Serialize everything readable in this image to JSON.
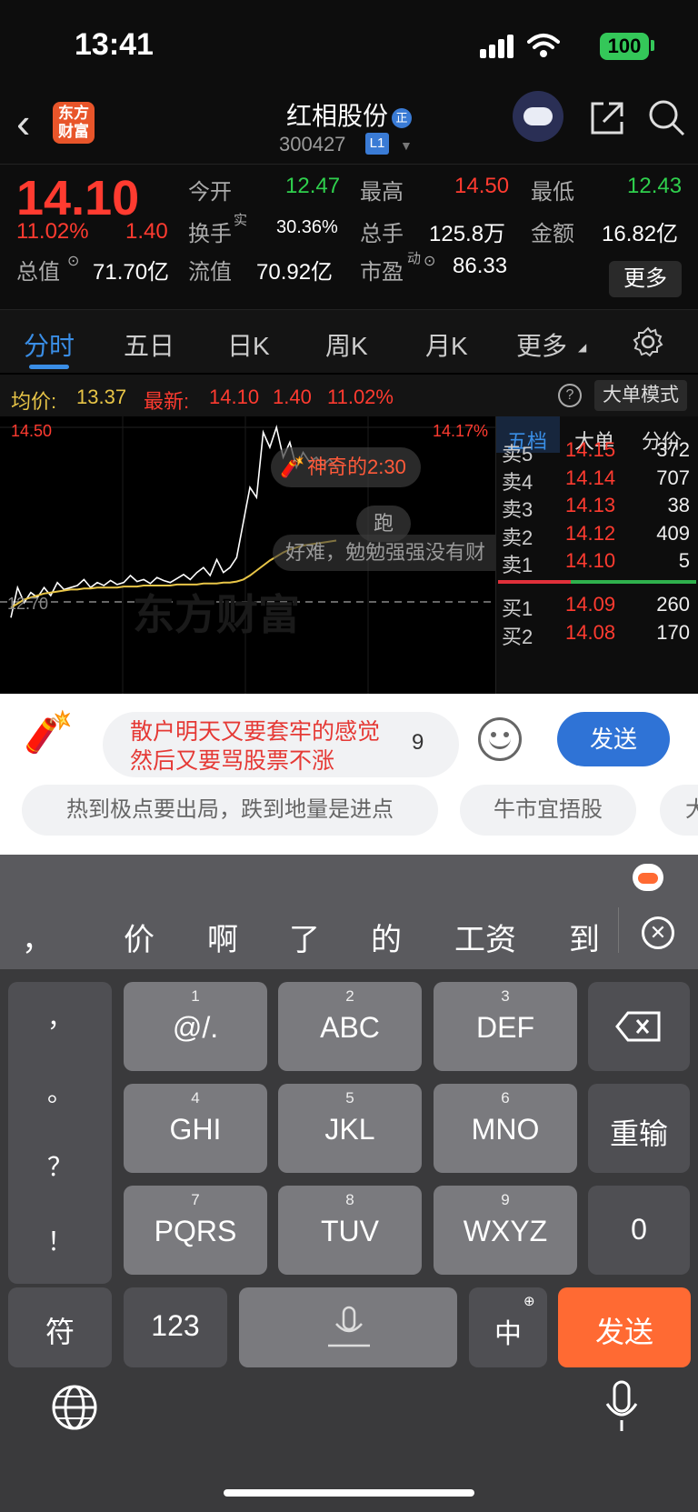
{
  "status": {
    "time": "13:41",
    "battery": "100"
  },
  "nav": {
    "brand": "东方财富",
    "title": "红相股份",
    "title_badge": "正",
    "code": "300427",
    "level": "L1"
  },
  "quote": {
    "price": "14.10",
    "change_pct": "11.02%",
    "change": "1.40",
    "open_label": "今开",
    "open": "12.47",
    "high_label": "最高",
    "high": "14.50",
    "low_label": "最低",
    "low": "12.43",
    "turnover_label": "换手",
    "turnover_sup": "实",
    "turnover": "30.36%",
    "volume_label": "总手",
    "volume": "125.8万",
    "amount_label": "金额",
    "amount": "16.82亿",
    "mktcap_label": "总值",
    "mktcap": "71.70亿",
    "float_label": "流值",
    "float": "70.92亿",
    "pe_label": "市盈",
    "pe_sup": "动",
    "pe": "86.33",
    "more": "更多"
  },
  "tabs": [
    "分时",
    "五日",
    "日K",
    "周K",
    "月K",
    "更多"
  ],
  "priceline": {
    "avg_label": "均价:",
    "avg": "13.37",
    "last_label": "最新:",
    "last": "14.10",
    "chg": "1.40",
    "pct": "11.02%",
    "mode": "大单模式"
  },
  "chart": {
    "high_label": "14.50",
    "pct_label": "14.17%",
    "base_label": "12.70",
    "watermark": "东方财富",
    "danmaku": [
      "神奇的2:30",
      "跑",
      "好难，勉勉强强没有财"
    ]
  },
  "chart_data": {
    "type": "line",
    "ylim": [
      12.43,
      14.5
    ],
    "series": [
      {
        "values": [
          12.6,
          12.9,
          12.75,
          12.85,
          12.8,
          12.9,
          12.82,
          12.95,
          12.88,
          12.9,
          12.92,
          12.98,
          12.9,
          12.95,
          12.92,
          12.97,
          12.93,
          12.95,
          13.02,
          12.96,
          12.98,
          12.94,
          13.0,
          12.97,
          12.95,
          12.99,
          13.03,
          12.98,
          13.05,
          13.1,
          13.02,
          13.18,
          13.05,
          13.1,
          13.2,
          13.55,
          13.9,
          13.8,
          14.45,
          14.3,
          14.5,
          14.2,
          14.35,
          14.1,
          14.25,
          14.15,
          14.2,
          14.12,
          14.18,
          14.1
        ]
      },
      {
        "values": [
          12.7,
          12.74,
          12.78,
          12.8,
          12.82,
          12.84,
          12.85,
          12.86,
          12.87,
          12.88,
          12.88,
          12.89,
          12.89,
          12.9,
          12.9,
          12.9,
          12.9,
          12.91,
          12.91,
          12.91,
          12.92,
          12.92,
          12.92,
          12.92,
          12.92,
          12.93,
          12.93,
          12.93,
          12.93,
          12.94,
          12.94,
          12.94,
          12.95,
          12.95,
          12.96,
          12.98,
          13.02,
          13.07,
          13.12,
          13.17,
          13.21,
          13.25,
          13.28,
          13.3,
          13.32,
          13.33,
          13.34,
          13.35,
          13.36,
          13.37
        ]
      }
    ]
  },
  "book": {
    "tabs": [
      "五档",
      "大单",
      "分价"
    ],
    "asks": [
      {
        "label": "卖5",
        "price": "14.15",
        "vol": "372"
      },
      {
        "label": "卖4",
        "price": "14.14",
        "vol": "707"
      },
      {
        "label": "卖3",
        "price": "14.13",
        "vol": "38"
      },
      {
        "label": "卖2",
        "price": "14.12",
        "vol": "409"
      },
      {
        "label": "卖1",
        "price": "14.10",
        "vol": "5"
      }
    ],
    "bids": [
      {
        "label": "买1",
        "price": "14.09",
        "vol": "260"
      },
      {
        "label": "买2",
        "price": "14.08",
        "vol": "170"
      }
    ]
  },
  "composer": {
    "text": "散户明天又要套牢的感觉 然后又要骂股票不涨",
    "count": "9",
    "send": "发送",
    "chips": [
      "热到极点要出局，跌到地量是进点",
      "牛市宜捂股",
      "大"
    ]
  },
  "keyboard": {
    "candidates": [
      "，",
      "价",
      "啊",
      "了",
      "的",
      "工资",
      "到"
    ],
    "punct": [
      "，",
      "。",
      "？",
      "！"
    ],
    "keys": [
      {
        "num": "1",
        "main": "@/."
      },
      {
        "num": "2",
        "main": "ABC"
      },
      {
        "num": "3",
        "main": "DEF"
      },
      {
        "num": "4",
        "main": "GHI"
      },
      {
        "num": "5",
        "main": "JKL"
      },
      {
        "num": "6",
        "main": "MNO"
      },
      {
        "num": "7",
        "main": "PQRS"
      },
      {
        "num": "8",
        "main": "TUV"
      },
      {
        "num": "9",
        "main": "WXYZ"
      }
    ],
    "reinput": "重输",
    "zero": "0",
    "symbols": "符",
    "numbers": "123",
    "lang": "中",
    "send": "发送"
  }
}
